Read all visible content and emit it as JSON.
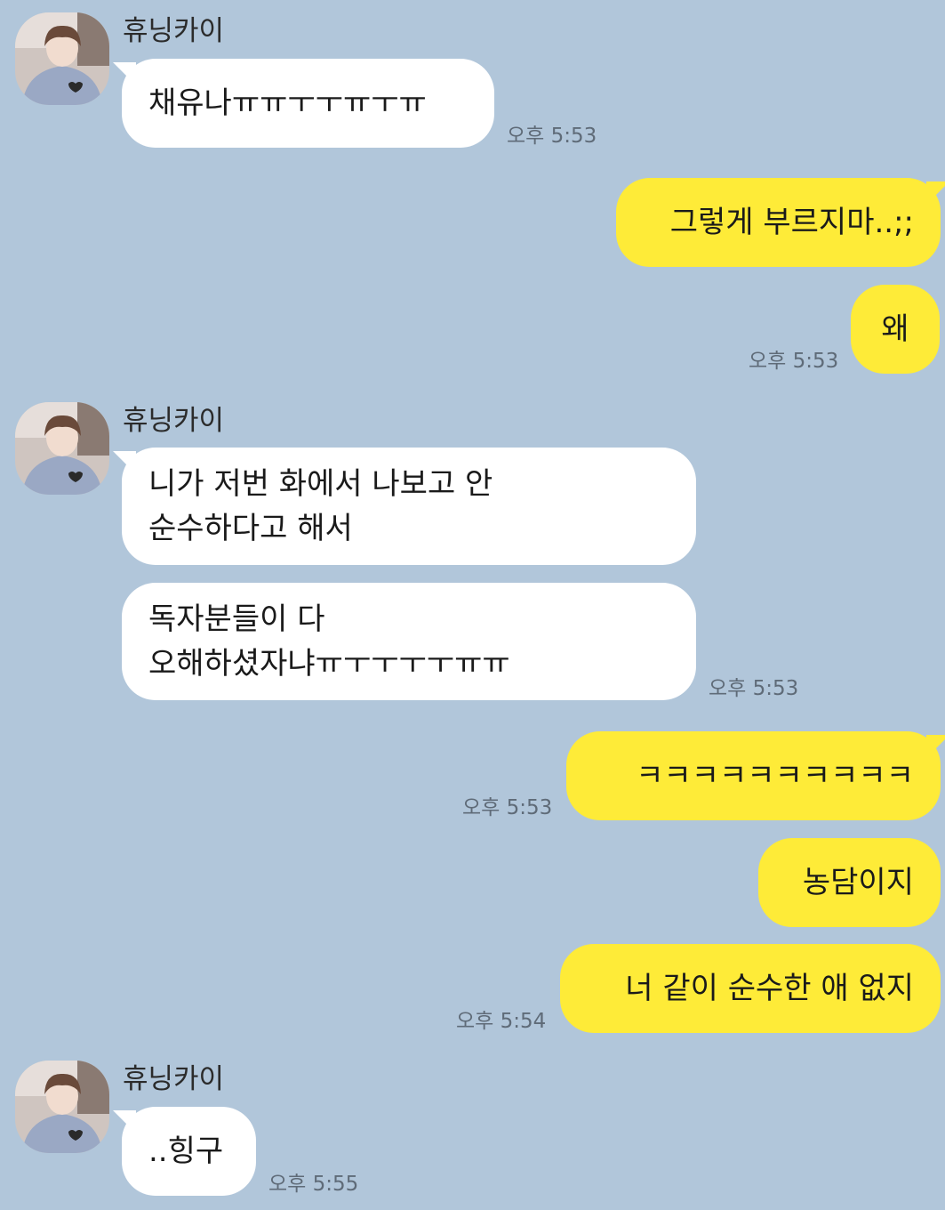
{
  "colors": {
    "background": "#B1C6DA",
    "incoming_bubble": "#FFFFFF",
    "outgoing_bubble": "#FEEB38"
  },
  "sender_name": "휴닝카이",
  "messages": [
    {
      "text": "채유나ㅠㅠㅜㅜㅠㅜㅠ"
    },
    {
      "time": "오후 5:53"
    },
    {
      "text": "그렇게 부르지마..;;"
    },
    {
      "text": "왜"
    },
    {
      "time": "오후 5:53"
    },
    {
      "line1": "니가 저번 화에서 나보고 안",
      "line2": "순수하다고 해서"
    },
    {
      "line1": "독자분들이 다",
      "line2": "오해하셨자냐ㅠㅜㅜㅜㅜㅠㅠ"
    },
    {
      "time": "오후 5:53"
    },
    {
      "text": "ㅋㅋㅋㅋㅋㅋㅋㅋㅋㅋ"
    },
    {
      "time": "오후 5:53"
    },
    {
      "text": "농담이지"
    },
    {
      "text": "너 같이 순수한 애 없지"
    },
    {
      "time": "오후 5:54"
    },
    {
      "text": "..힝구"
    },
    {
      "time": "오후 5:55"
    }
  ]
}
